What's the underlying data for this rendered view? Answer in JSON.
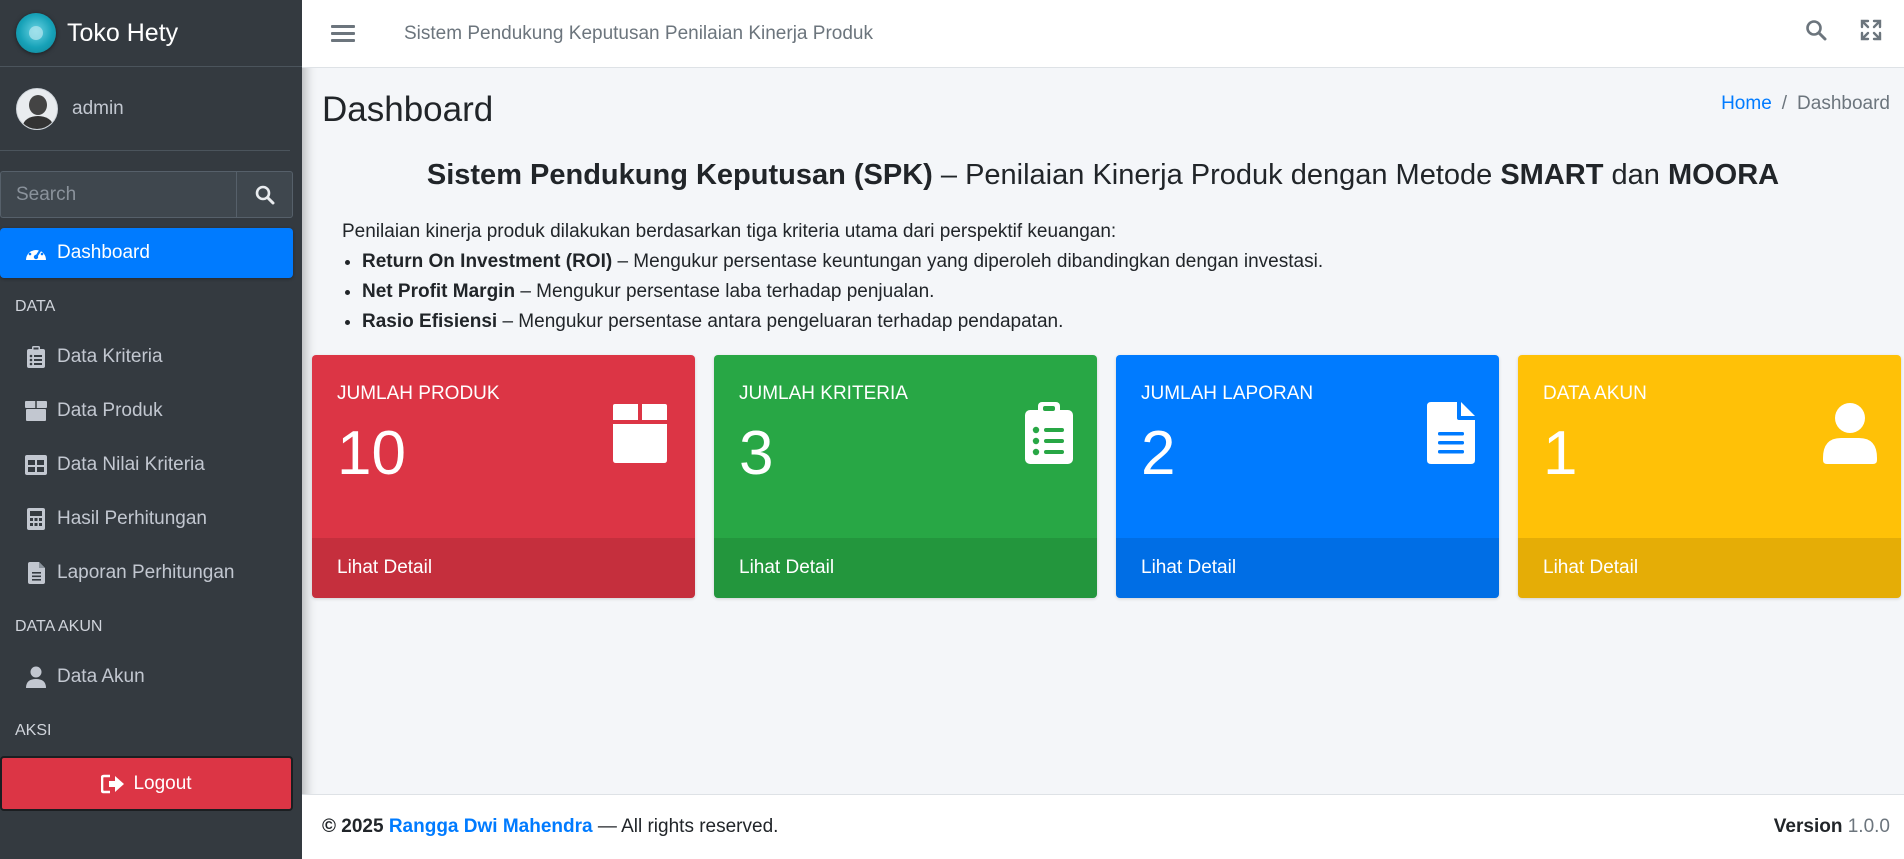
{
  "brand": {
    "name": "Toko Hety"
  },
  "user": {
    "name": "admin"
  },
  "search": {
    "placeholder": "Search"
  },
  "nav": {
    "dashboard": "Dashboard",
    "section_data": "DATA",
    "data_kriteria": "Data Kriteria",
    "data_produk": "Data Produk",
    "data_nilai_kriteria": "Data Nilai Kriteria",
    "hasil_perhitungan": "Hasil Perhitungan",
    "laporan_perhitungan": "Laporan Perhitungan",
    "section_akun": "DATA AKUN",
    "data_akun": "Data Akun",
    "section_aksi": "AKSI",
    "logout": "Logout"
  },
  "topbar": {
    "title": "Sistem Pendukung Keputusan Penilaian Kinerja Produk"
  },
  "page": {
    "title": "Dashboard",
    "breadcrumb_home": "Home",
    "breadcrumb_sep": "/",
    "breadcrumb_current": "Dashboard"
  },
  "headline": {
    "part1": "Sistem Pendukung Keputusan (SPK)",
    "part2": " – Penilaian Kinerja Produk dengan Metode ",
    "part3": "SMART",
    "part4": " dan ",
    "part5": "MOORA"
  },
  "description": {
    "intro": "Penilaian kinerja produk dilakukan berdasarkan tiga kriteria utama dari perspektif keuangan:",
    "items": [
      {
        "term": "Return On Investment (ROI)",
        "text": " – Mengukur persentase keuntungan yang diperoleh dibandingkan dengan investasi."
      },
      {
        "term": "Net Profit Margin",
        "text": " – Mengukur persentase laba terhadap penjualan."
      },
      {
        "term": "Rasio Efisiensi",
        "text": " – Mengukur persentase antara pengeluaran terhadap pendapatan."
      }
    ]
  },
  "boxes": [
    {
      "label": "JUMLAH PRODUK",
      "value": "10",
      "footer": "Lihat Detail",
      "color": "#dc3545",
      "icon": "box-open-icon"
    },
    {
      "label": "JUMLAH KRITERIA",
      "value": "3",
      "footer": "Lihat Detail",
      "color": "#28a745",
      "icon": "clipboard-list-icon"
    },
    {
      "label": "JUMLAH LAPORAN",
      "value": "2",
      "footer": "Lihat Detail",
      "color": "#007bff",
      "icon": "file-alt-icon"
    },
    {
      "label": "DATA AKUN",
      "value": "1",
      "footer": "Lihat Detail",
      "color": "#ffc107",
      "icon": "user-icon"
    }
  ],
  "footer": {
    "copyright": "© 2025",
    "author": "Rangga Dwi Mahendra",
    "rights": " — All rights reserved.",
    "version_label": "Version",
    "version": "1.0.0"
  }
}
